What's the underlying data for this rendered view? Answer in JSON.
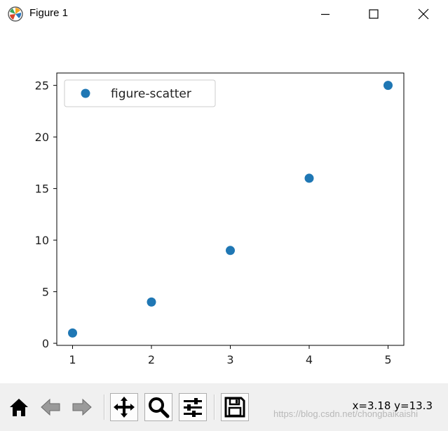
{
  "window": {
    "title": "Figure 1",
    "icon": "matplotlib-logo-icon"
  },
  "window_controls": [
    {
      "name": "minimize-button",
      "icon": "minimize-icon"
    },
    {
      "name": "maximize-button",
      "icon": "maximize-icon"
    },
    {
      "name": "close-button",
      "icon": "close-icon"
    }
  ],
  "chart_data": {
    "type": "scatter",
    "series": [
      {
        "name": "figure-scatter",
        "x": [
          1,
          2,
          3,
          4,
          5
        ],
        "y": [
          1,
          4,
          9,
          16,
          25
        ],
        "color": "#1f77b4"
      }
    ],
    "xlim": [
      0.8,
      5.2
    ],
    "ylim": [
      -0.2,
      26.2
    ],
    "xticks": [
      1,
      2,
      3,
      4,
      5
    ],
    "yticks": [
      0,
      5,
      10,
      15,
      20,
      25
    ],
    "title": "",
    "xlabel": "",
    "ylabel": "",
    "grid": false,
    "legend": "upper-left"
  },
  "toolbar": {
    "buttons": [
      {
        "name": "home-button",
        "icon": "home-icon"
      },
      {
        "name": "back-button",
        "icon": "back-arrow-icon"
      },
      {
        "name": "forward-button",
        "icon": "forward-arrow-icon"
      },
      {
        "name": "pan-button",
        "icon": "pan-icon"
      },
      {
        "name": "zoom-button",
        "icon": "zoom-icon"
      },
      {
        "name": "configure-subplots-button",
        "icon": "sliders-icon"
      },
      {
        "name": "save-button",
        "icon": "save-icon"
      }
    ],
    "coords": "x=3.18 y=13.3",
    "watermark": "https://blog.csdn.net/chongbaikaishi"
  }
}
